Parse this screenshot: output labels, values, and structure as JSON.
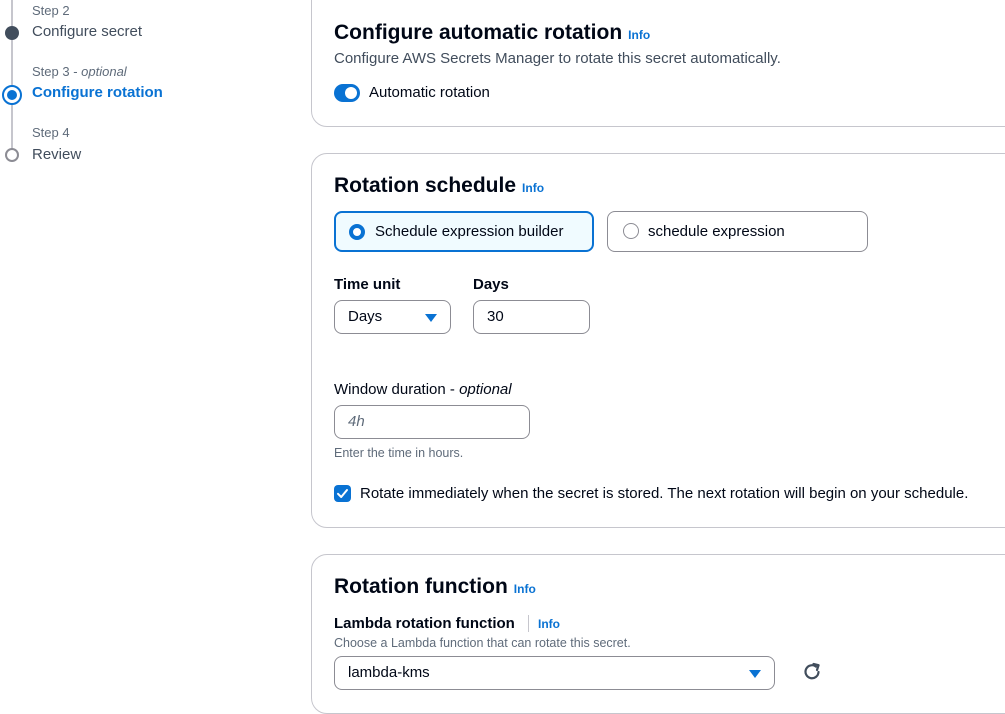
{
  "steps": [
    {
      "num": "Step 2",
      "title": "Configure secret",
      "state": "done"
    },
    {
      "num": "Step 3",
      "optional": "optional",
      "title": "Configure rotation",
      "state": "active"
    },
    {
      "num": "Step 4",
      "title": "Review",
      "state": "todo"
    }
  ],
  "auto_rotation": {
    "title": "Configure automatic rotation",
    "info": "Info",
    "description": "Configure AWS Secrets Manager to rotate this secret automatically.",
    "toggle_label": "Automatic rotation",
    "toggle_on": true
  },
  "schedule": {
    "title": "Rotation schedule",
    "info": "Info",
    "options": [
      "Schedule expression builder",
      "schedule expression"
    ],
    "selected": "Schedule expression builder",
    "time_unit_label": "Time unit",
    "time_unit_value": "Days",
    "days_label": "Days",
    "days_value": "30",
    "window_label": "Window duration - ",
    "window_optional": "optional",
    "window_placeholder": "4h",
    "window_hint": "Enter the time in hours.",
    "rotate_immediately_label": "Rotate immediately when the secret is stored. The next rotation will begin on your schedule.",
    "rotate_immediately_checked": true
  },
  "function": {
    "title": "Rotation function",
    "info": "Info",
    "lambda_label": "Lambda rotation function",
    "lambda_info": "Info",
    "lambda_hint": "Choose a Lambda function that can rotate this secret.",
    "lambda_value": "lambda-kms"
  },
  "colors": {
    "accent": "#0972d3",
    "text": "#000716",
    "muted": "#5f6b7a",
    "border": "#c6c6cd"
  }
}
